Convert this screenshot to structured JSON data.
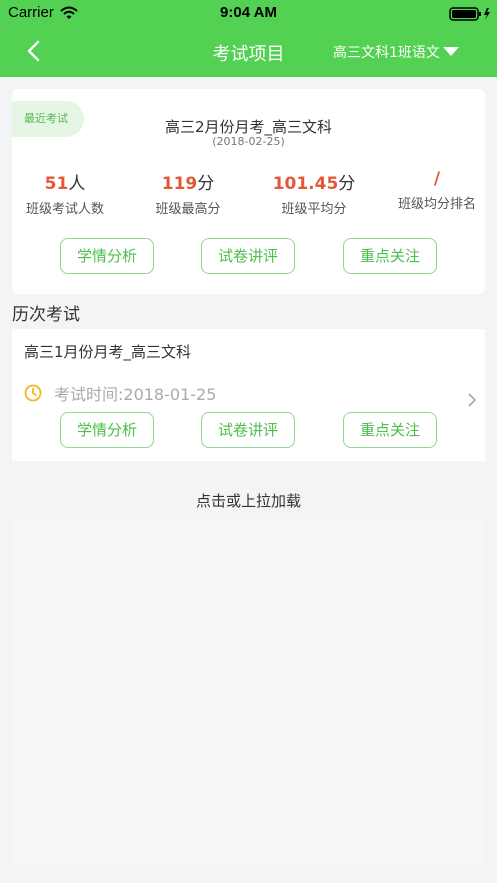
{
  "status_bar": {
    "carrier": "Carrier",
    "time": "9:04 AM"
  },
  "nav": {
    "title": "考试项目",
    "class_selector": "高三文科1班语文"
  },
  "recent": {
    "badge": "最近考试",
    "title": "高三2月份月考_高三文科",
    "date": "(2018-02-25)",
    "stats": [
      {
        "value": "51",
        "unit": "人",
        "label": "班级考试人数"
      },
      {
        "value": "119",
        "unit": "分",
        "label": "班级最高分"
      },
      {
        "value": "101.45",
        "unit": "分",
        "label": "班级平均分"
      },
      {
        "value": "/",
        "unit": "",
        "label": "班级均分排名"
      }
    ],
    "actions": [
      "学情分析",
      "试卷讲评",
      "重点关注"
    ]
  },
  "history": {
    "heading": "历次考试",
    "items": [
      {
        "title": "高三1月份月考_高三文科",
        "time": "考试时间:2018-01-25",
        "actions": [
          "学情分析",
          "试卷讲评",
          "重点关注"
        ]
      }
    ]
  },
  "load_more": "点击或上拉加载",
  "colors": {
    "header": "#52d152",
    "accent": "#4cbf4c",
    "highlight": "#e35838"
  }
}
